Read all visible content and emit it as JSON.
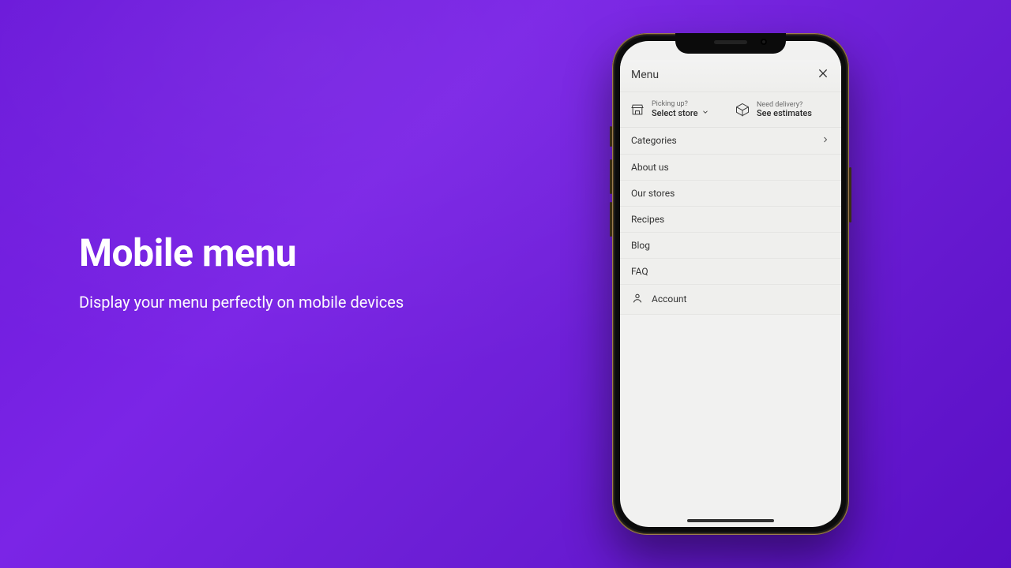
{
  "hero": {
    "title": "Mobile menu",
    "subtitle": "Display your menu perfectly on mobile devices"
  },
  "app": {
    "header": {
      "title": "Menu"
    },
    "pickup": {
      "label": "Picking up?",
      "value": "Select store"
    },
    "delivery": {
      "label": "Need delivery?",
      "value": "See estimates"
    },
    "items": [
      {
        "label": "Categories",
        "chevron": true
      },
      {
        "label": "About us"
      },
      {
        "label": "Our stores"
      },
      {
        "label": "Recipes"
      },
      {
        "label": "Blog"
      },
      {
        "label": "FAQ"
      }
    ],
    "account": {
      "label": "Account"
    }
  }
}
